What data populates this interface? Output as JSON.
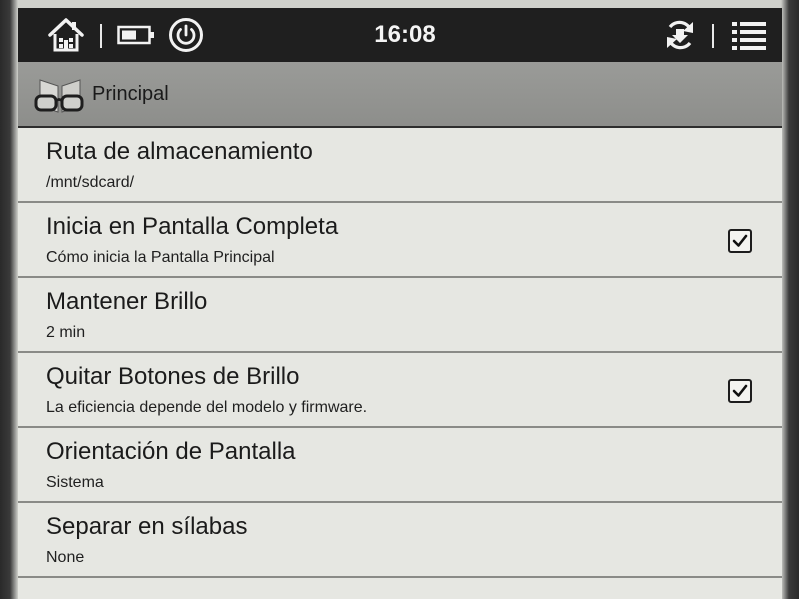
{
  "statusbar": {
    "home_icon": "home-icon",
    "battery_icon": "battery-icon",
    "power_icon": "power-icon",
    "time": "16:08",
    "sync_icon": "sync-icon",
    "menu_icon": "menu-list-icon"
  },
  "titlebar": {
    "icon": "glasses-book-icon",
    "title": "Principal"
  },
  "settings": [
    {
      "title": "Ruta de almacenamiento",
      "subtitle": "/mnt/sdcard/",
      "checkbox": null
    },
    {
      "title": "Inicia en Pantalla Completa",
      "subtitle": "Cómo inicia la Pantalla Principal",
      "checkbox": true
    },
    {
      "title": "Mantener Brillo",
      "subtitle": "2 min",
      "checkbox": null
    },
    {
      "title": "Quitar Botones de Brillo",
      "subtitle": "La eficiencia depende del modelo y firmware.",
      "checkbox": true
    },
    {
      "title": "Orientación de Pantalla",
      "subtitle": "Sistema",
      "checkbox": null
    },
    {
      "title": "Separar en sílabas",
      "subtitle": "None",
      "checkbox": null
    }
  ],
  "colors": {
    "statusbar_bg": "#1f1f1f",
    "titlebar_bg": "#8d8e8b",
    "list_bg": "#e6e7e2",
    "divider": "#8a8b87",
    "text": "#1b1b1b"
  }
}
